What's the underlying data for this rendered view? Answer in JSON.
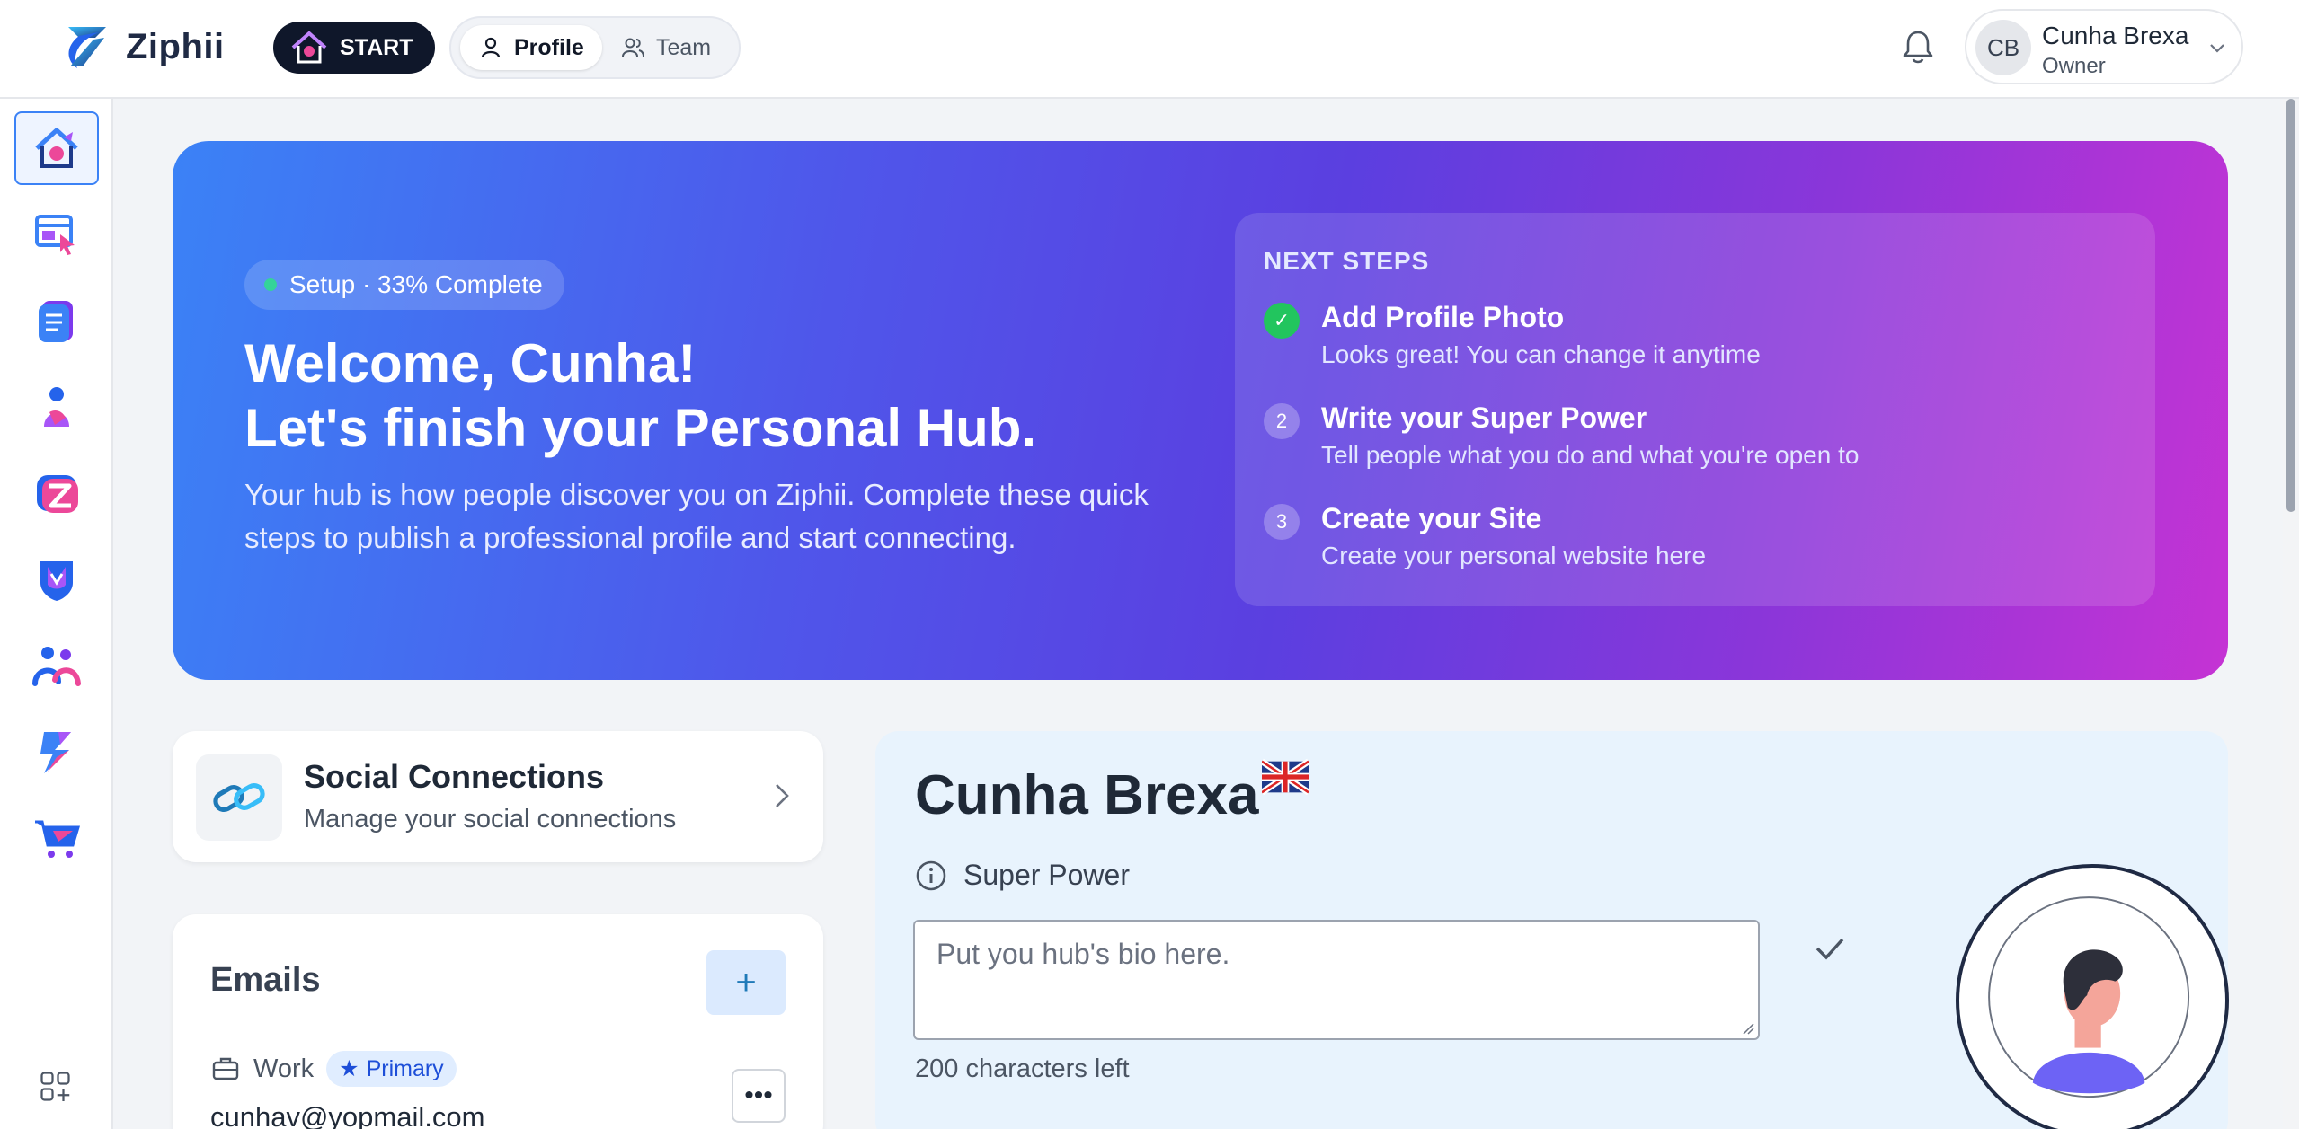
{
  "app": {
    "name": "Ziphii",
    "start_label": "START"
  },
  "nav": {
    "tabs": [
      {
        "label": "Profile",
        "icon": "user-icon",
        "active": true
      },
      {
        "label": "Team",
        "icon": "users-icon",
        "active": false
      }
    ]
  },
  "user": {
    "initials": "CB",
    "name": "Cunha Brexa",
    "role": "Owner"
  },
  "sidebar": {
    "items": [
      {
        "name": "home-hub-icon",
        "active": true
      },
      {
        "name": "site-builder-icon",
        "active": false
      },
      {
        "name": "documents-icon",
        "active": false
      },
      {
        "name": "person-icon",
        "active": false
      },
      {
        "name": "z-app-icon",
        "active": false
      },
      {
        "name": "shield-app-icon",
        "active": false
      },
      {
        "name": "community-icon",
        "active": false
      },
      {
        "name": "lightning-app-icon",
        "active": false
      },
      {
        "name": "shop-cart-icon",
        "active": false
      }
    ],
    "bottom_icon": "add-apps-icon"
  },
  "hero": {
    "badge": "Setup · 33% Complete",
    "progress_percent": 33,
    "title_line1": "Welcome, Cunha!",
    "title_line2": "Let's finish your Personal Hub.",
    "description": "Your hub is how people discover you on Ziphii. Complete these quick steps to publish a professional profile and start connecting.",
    "next_steps_heading": "NEXT STEPS",
    "steps": [
      {
        "marker": "✓",
        "title": "Add Profile Photo",
        "desc": "Looks great! You can change it anytime",
        "done": true
      },
      {
        "marker": "2",
        "title": "Write your Super Power",
        "desc": "Tell people what you do and what you're open to",
        "done": false
      },
      {
        "marker": "3",
        "title": "Create your Site",
        "desc": "Create your personal website here",
        "done": false
      }
    ]
  },
  "social": {
    "title": "Social Connections",
    "subtitle": "Manage your social connections"
  },
  "emails": {
    "title": "Emails",
    "add_label": "+",
    "items": [
      {
        "type": "Work",
        "badge": "Primary",
        "value": "cunhav@yopmail.com",
        "more_label": "•••"
      }
    ]
  },
  "profile": {
    "name": "Cunha Brexa",
    "flag": "uk-flag-icon",
    "super_power_label": "Super Power",
    "bio_placeholder": "Put you hub's bio here.",
    "chars_left": "200 characters left"
  },
  "colors": {
    "accent": "#3b82f6",
    "hero_start": "#3b82f6",
    "hero_end": "#c533d4",
    "done_green": "#22c55e"
  }
}
